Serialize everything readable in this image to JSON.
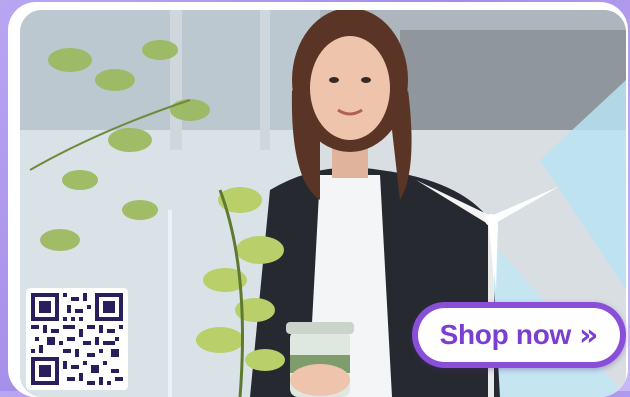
{
  "banner": {
    "qr_code_icon": "qr-code-icon",
    "cta": {
      "label": "Shop now",
      "chevron": "»",
      "icon": "double-chevron-right-icon"
    }
  },
  "colors": {
    "accent": "#7a3fd0",
    "button_border": "#8a4fd8",
    "background": "#a38ce8"
  }
}
